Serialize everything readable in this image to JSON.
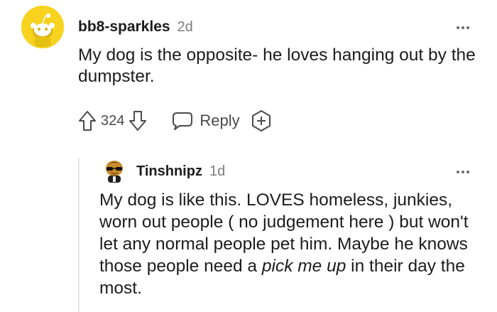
{
  "comments": [
    {
      "username": "bb8-sparkles",
      "age": "2d",
      "text": "My dog is the opposite- he loves hanging out by the dumpster.",
      "votes": "324",
      "reply_label": "Reply",
      "icons": [
        "snoo-avatar",
        "upvote-icon",
        "downvote-icon",
        "reply-bubble-icon",
        "award-plus-icon",
        "more-options-icon"
      ]
    },
    {
      "username": "Tinshnipz",
      "age": "1d",
      "text_main": "My dog is like this. LOVES homeless, junkies, worn out people ( no judgement here ) but won't let any normal people pet him. Maybe he knows those people need a",
      "text_italic": "pick me up",
      "text_end": "in their day the most.",
      "icons": [
        "sunglasses-character-avatar",
        "more-options-icon"
      ]
    }
  ],
  "colors": {
    "avatar_yellow": "#f7d21e",
    "text": "#1c1c1c",
    "muted": "#7c7c7c",
    "icon": "#4a4a4a",
    "thread_line": "#e6e6e6"
  }
}
